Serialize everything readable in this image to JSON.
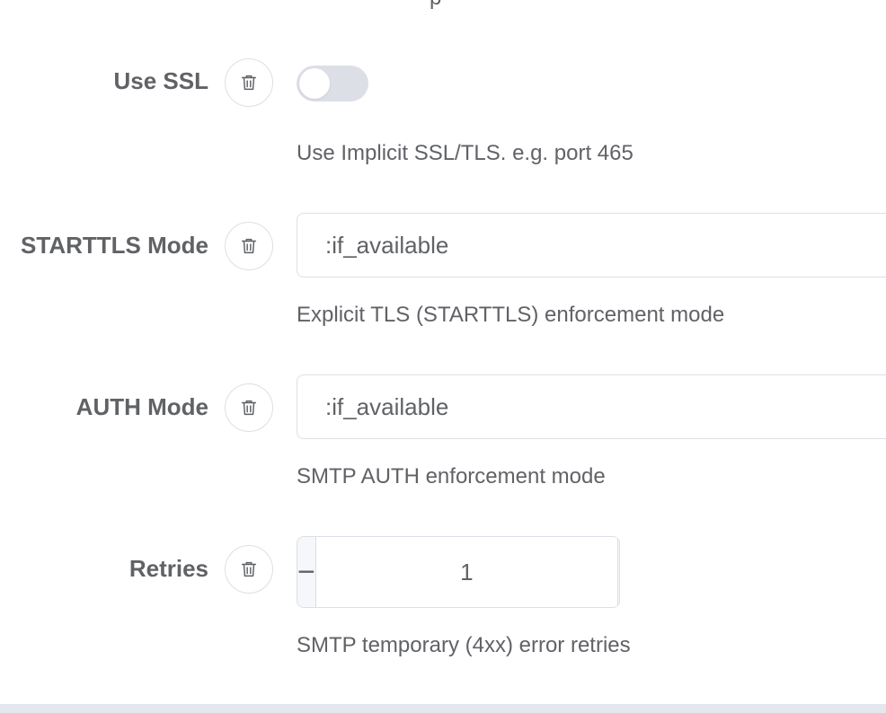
{
  "top_fragment": "p",
  "fields": {
    "use_ssl": {
      "label": "Use SSL",
      "enabled": false,
      "help": "Use Implicit SSL/TLS. e.g. port 465"
    },
    "starttls_mode": {
      "label": "STARTTLS Mode",
      "value": ":if_available",
      "help": "Explicit TLS (STARTTLS) enforcement mode"
    },
    "auth_mode": {
      "label": "AUTH Mode",
      "value": ":if_available",
      "help": "SMTP AUTH enforcement mode"
    },
    "retries": {
      "label": "Retries",
      "value": "1",
      "minus_symbol": "−",
      "plus_symbol": "+",
      "help": "SMTP temporary (4xx) error retries"
    }
  },
  "icons": {
    "delete": "trash-icon",
    "decrement": "minus-icon",
    "increment": "plus-icon"
  },
  "colors": {
    "text": "#606266",
    "border": "#dcdfe6",
    "toggle_off": "#dcdfe6",
    "stepper_button_bg": "#f5f7fa"
  }
}
